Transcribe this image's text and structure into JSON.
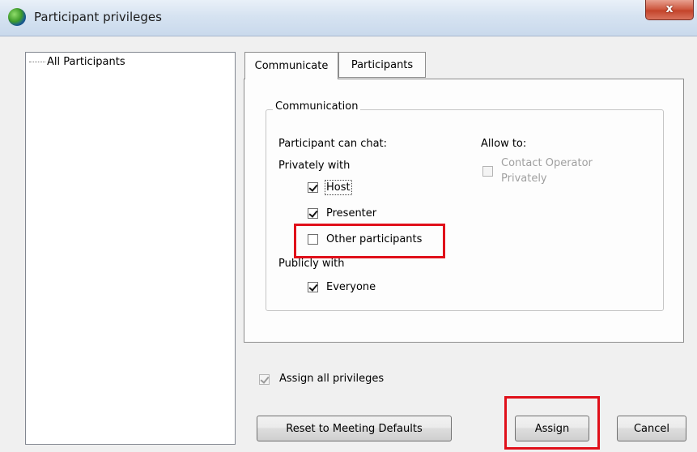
{
  "window": {
    "title": "Participant privileges",
    "close_glyph": "x"
  },
  "tree": {
    "items": [
      {
        "label": "All Participants"
      }
    ]
  },
  "tabs": [
    {
      "label": "Communicate",
      "active": true
    },
    {
      "label": "Participants",
      "active": false
    }
  ],
  "communication": {
    "group_title": "Communication",
    "chat_heading": "Participant can chat:",
    "privately_heading": "Privately with",
    "private_options": [
      {
        "label": "Host",
        "checked": true
      },
      {
        "label": "Presenter",
        "checked": true
      },
      {
        "label": "Other participants",
        "checked": false
      }
    ],
    "publicly_heading": "Publicly with",
    "public_options": [
      {
        "label": "Everyone",
        "checked": true
      }
    ],
    "allow_heading": "Allow to:",
    "allow_option": {
      "line1": "Contact Operator",
      "line2": "Privately",
      "checked": false,
      "disabled": true
    }
  },
  "assign_all": {
    "label": "Assign all privileges",
    "checked": true,
    "disabled": true
  },
  "buttons": {
    "reset": "Reset to Meeting Defaults",
    "assign": "Assign",
    "cancel": "Cancel"
  },
  "colors": {
    "highlight": "#e0101a"
  }
}
